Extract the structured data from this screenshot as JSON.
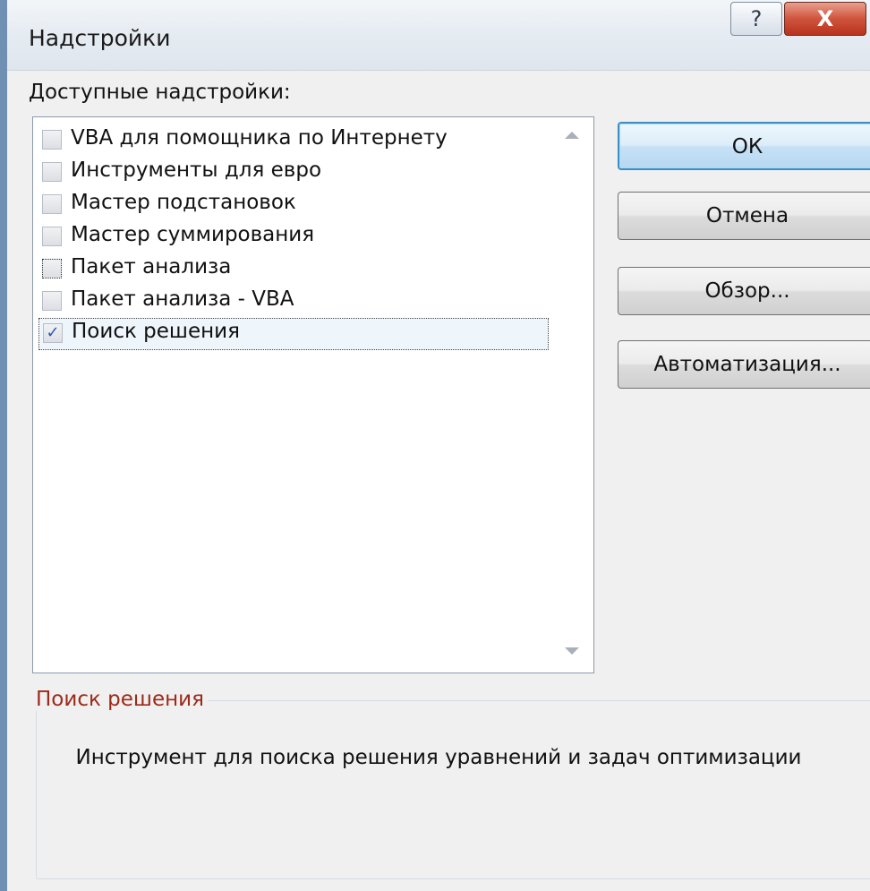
{
  "window": {
    "title": "Надстройки",
    "help_glyph": "?",
    "close_glyph": "X"
  },
  "list": {
    "label": "Доступные надстройки:",
    "items": [
      {
        "label": "VBA для помощника по Интернету",
        "checked": false
      },
      {
        "label": "Инструменты для евро",
        "checked": false
      },
      {
        "label": "Мастер подстановок",
        "checked": false
      },
      {
        "label": "Мастер суммирования",
        "checked": false
      },
      {
        "label": "Пакет анализа",
        "checked": false
      },
      {
        "label": "Пакет анализа - VBA",
        "checked": false
      },
      {
        "label": "Поиск решения",
        "checked": true
      }
    ],
    "check_glyph": "✓"
  },
  "buttons": {
    "ok": "ОК",
    "cancel": "Отмена",
    "browse": "Обзор...",
    "automation": "Автоматизация..."
  },
  "description": {
    "title": "Поиск решения",
    "text": "Инструмент для поиска решения уравнений и задач оптимизации"
  },
  "colors": {
    "default_button_border": "#3d8ec8",
    "group_title": "#9c2a1a",
    "close_button": "#c7432c",
    "window_frame": "#6f8fb3"
  }
}
